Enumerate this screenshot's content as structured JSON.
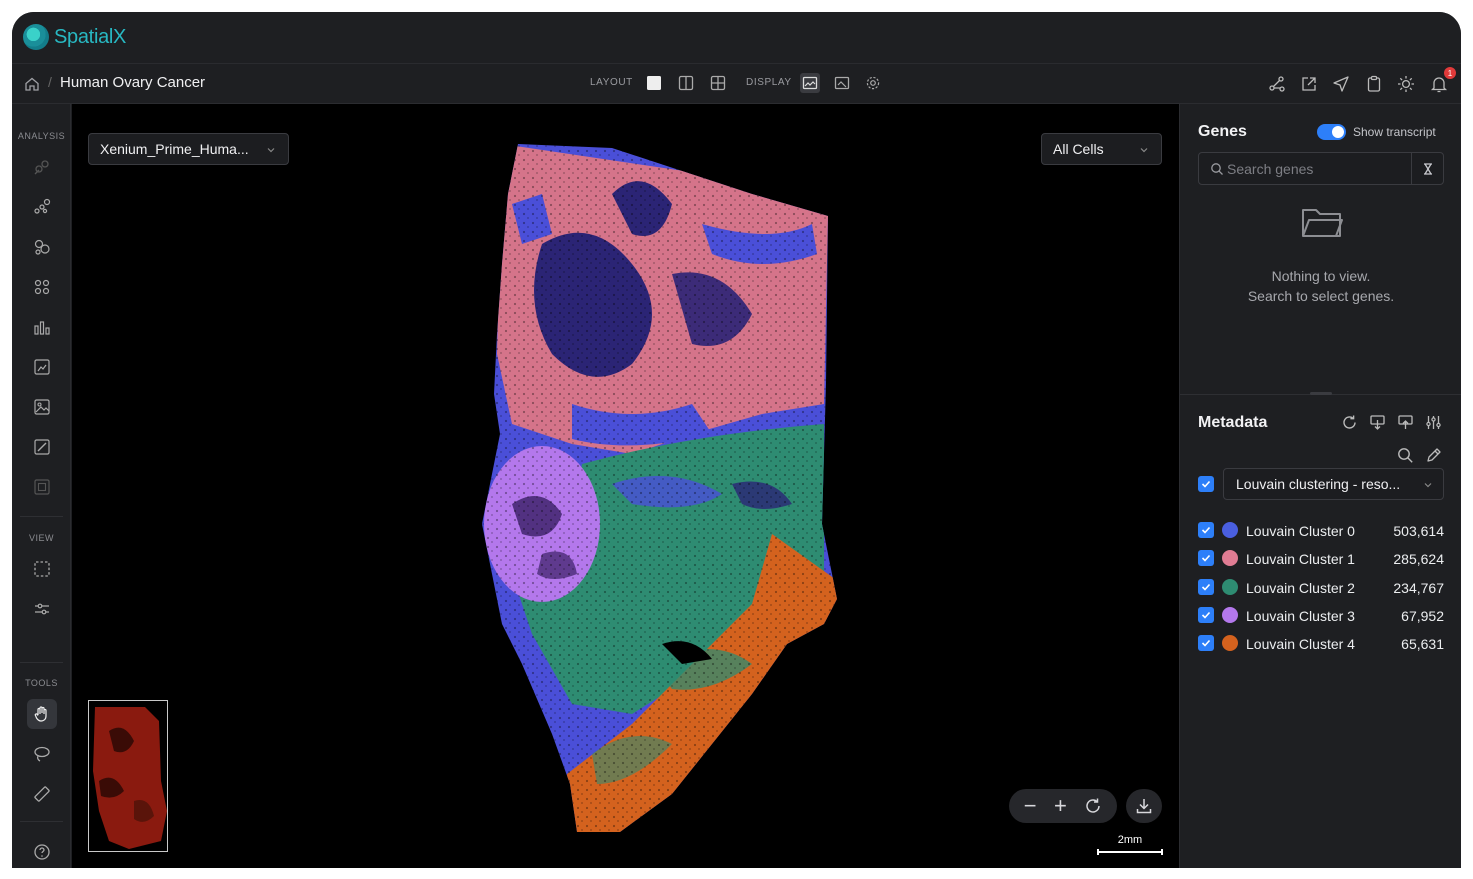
{
  "app": {
    "name": "SpatialX"
  },
  "breadcrumb": {
    "title": "Human Ovary Cancer"
  },
  "toolbar": {
    "layout_label": "LAYOUT",
    "display_label": "DISPLAY",
    "notification_count": "1"
  },
  "sidebar": {
    "analysis_label": "ANALYSIS",
    "view_label": "VIEW",
    "tools_label": "TOOLS"
  },
  "viewer": {
    "dataset_select": "Xenium_Prime_Huma...",
    "cells_select": "All Cells",
    "zoom_out": "−",
    "zoom_in": "+",
    "scale_label": "2mm"
  },
  "genes": {
    "title": "Genes",
    "toggle_label": "Show transcript",
    "toggle_on": true,
    "search_placeholder": "Search genes",
    "empty_line1": "Nothing to view.",
    "empty_line2": "Search to select genes."
  },
  "metadata": {
    "title": "Metadata",
    "selected_field": "Louvain clustering - reso...",
    "clusters": [
      {
        "name": "Louvain Cluster 0",
        "count": "503,614",
        "color": "#4a5fe0"
      },
      {
        "name": "Louvain Cluster 1",
        "count": "285,624",
        "color": "#e07c93"
      },
      {
        "name": "Louvain Cluster 2",
        "count": "234,767",
        "color": "#2e8c72"
      },
      {
        "name": "Louvain Cluster 3",
        "count": "67,952",
        "color": "#b478ec"
      },
      {
        "name": "Louvain Cluster 4",
        "count": "65,631",
        "color": "#d4621e"
      }
    ]
  },
  "colors": {
    "accent": "#2d7ff9",
    "brand": "#28b8c2",
    "background": "#1e1f22",
    "viewer_bg": "#000000"
  }
}
